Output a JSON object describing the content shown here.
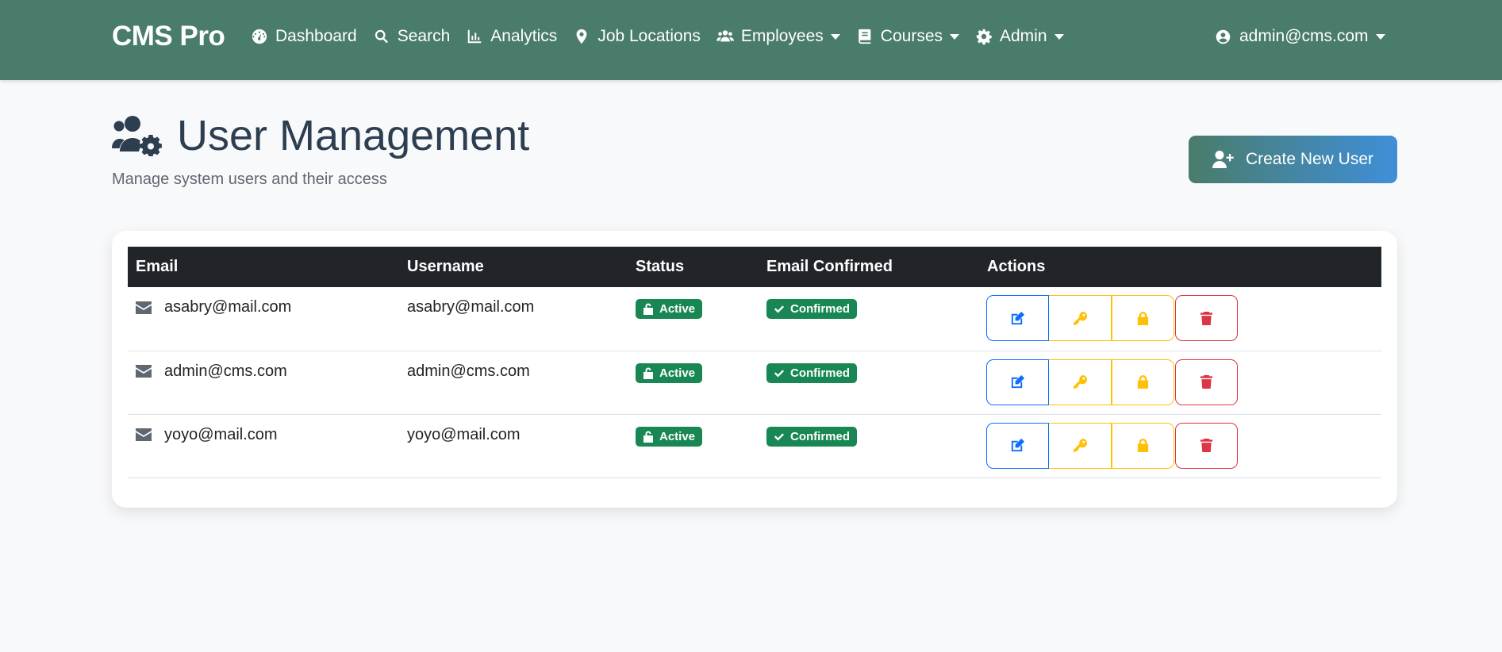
{
  "navbar": {
    "brand": "CMS Pro",
    "items": [
      {
        "label": "Dashboard",
        "icon": "tachometer-icon",
        "dropdown": false
      },
      {
        "label": "Search",
        "icon": "search-icon",
        "dropdown": false
      },
      {
        "label": "Analytics",
        "icon": "chart-icon",
        "dropdown": false
      },
      {
        "label": "Job Locations",
        "icon": "map-pin-icon",
        "dropdown": false
      },
      {
        "label": "Employees",
        "icon": "users-icon",
        "dropdown": true
      },
      {
        "label": "Courses",
        "icon": "book-icon",
        "dropdown": true
      },
      {
        "label": "Admin",
        "icon": "gear-icon",
        "dropdown": true
      }
    ],
    "user": "admin@cms.com"
  },
  "header": {
    "title": "User Management",
    "subtitle": "Manage system users and their access",
    "create_button": "Create New User"
  },
  "table": {
    "columns": [
      "Email",
      "Username",
      "Status",
      "Email Confirmed",
      "Actions"
    ],
    "rows": [
      {
        "email": "asabry@mail.com",
        "username": "asabry@mail.com",
        "status": "Active",
        "confirmed": "Confirmed"
      },
      {
        "email": "admin@cms.com",
        "username": "admin@cms.com",
        "status": "Active",
        "confirmed": "Confirmed"
      },
      {
        "email": "yoyo@mail.com",
        "username": "yoyo@mail.com",
        "status": "Active",
        "confirmed": "Confirmed"
      }
    ]
  },
  "colors": {
    "navbar": "#4a7c6b",
    "success": "#198754",
    "primary": "#0d6efd",
    "warning": "#ffc107",
    "danger": "#dc3545",
    "table_header": "#212529"
  }
}
